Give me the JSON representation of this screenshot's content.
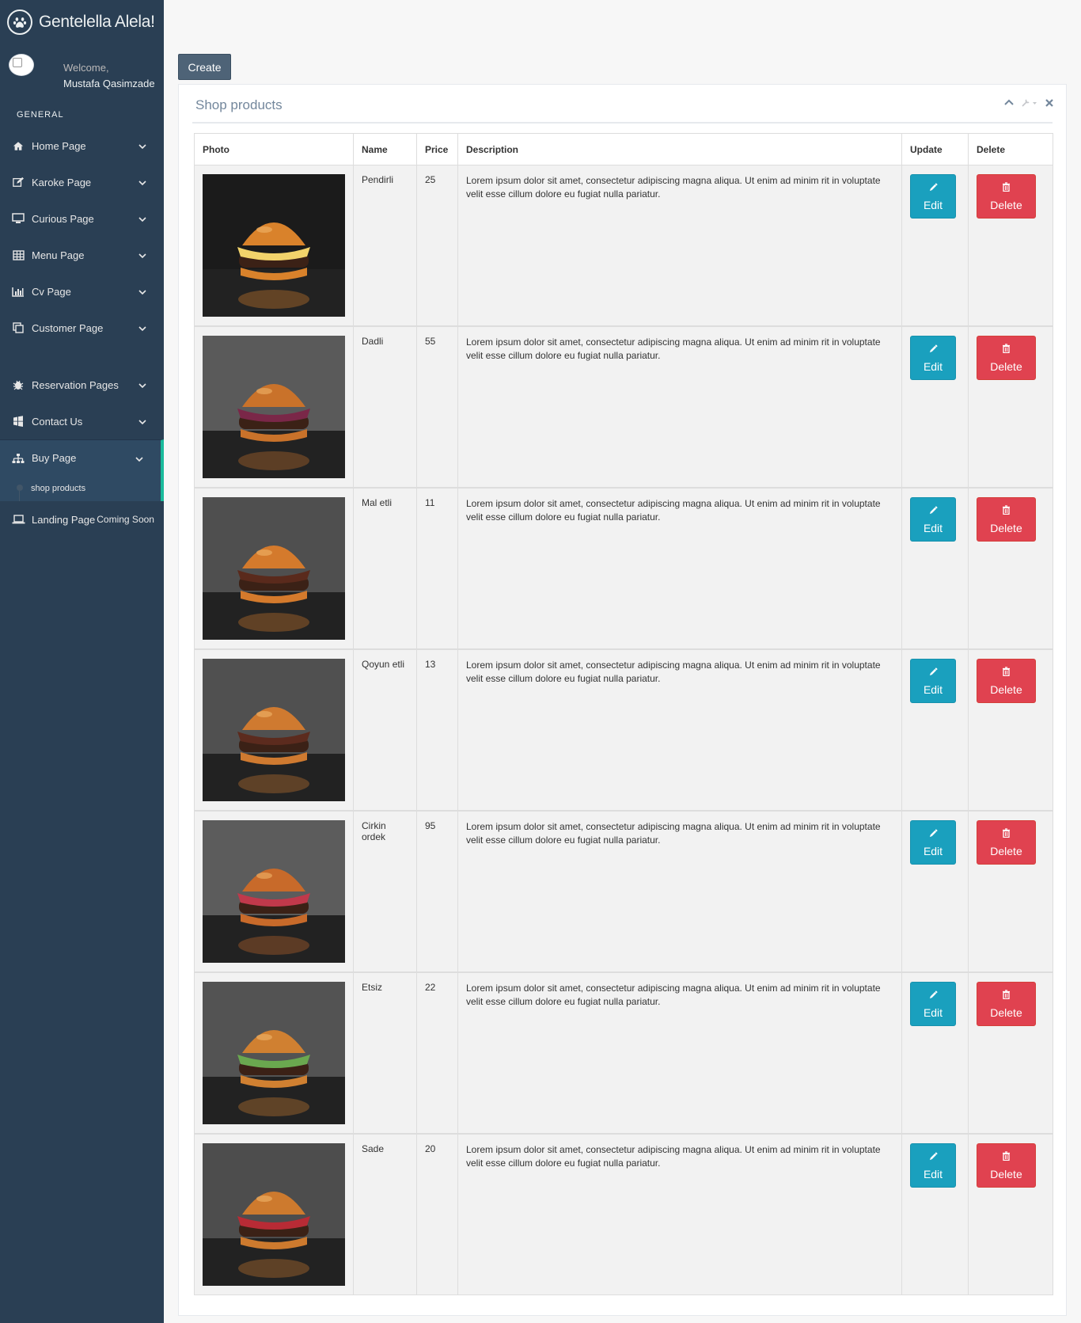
{
  "app": {
    "title": "Gentelella Alela!"
  },
  "profile": {
    "welcome": "Welcome,",
    "name": "Mustafa Qasimzade"
  },
  "sidebar": {
    "heading": "GENERAL",
    "items": [
      {
        "label": "Home Page",
        "icon": "home-icon"
      },
      {
        "label": "Karoke Page",
        "icon": "edit-icon"
      },
      {
        "label": "Curious Page",
        "icon": "desktop-icon"
      },
      {
        "label": "Menu Page",
        "icon": "table-icon"
      },
      {
        "label": "Cv Page",
        "icon": "bar-chart-icon"
      },
      {
        "label": "Customer Page",
        "icon": "clone-icon"
      },
      {
        "label": "Reservation Pages",
        "icon": "bug-icon"
      },
      {
        "label": "Contact Us",
        "icon": "windows-icon"
      },
      {
        "label": "Buy Page",
        "icon": "sitemap-icon"
      }
    ],
    "subitem": "shop products",
    "landing": {
      "label": "Landing Page",
      "badge": "Coming Soon",
      "icon": "laptop-icon"
    }
  },
  "toolbar": {
    "create_label": "Create"
  },
  "panel": {
    "title": "Shop products"
  },
  "table": {
    "headers": [
      "Photo",
      "Name",
      "Price",
      "Description",
      "Update",
      "Delete"
    ],
    "edit_label": "Edit",
    "delete_label": "Delete",
    "rows": [
      {
        "name": "Pendirli",
        "price": "25",
        "description": "Lorem ipsum dolor sit amet, consectetur adipiscing magna aliqua. Ut enim ad minim rit in voluptate velit esse cillum dolore eu fugiat nulla pariatur."
      },
      {
        "name": "Dadli",
        "price": "55",
        "description": "Lorem ipsum dolor sit amet, consectetur adipiscing magna aliqua. Ut enim ad minim rit in voluptate velit esse cillum dolore eu fugiat nulla pariatur."
      },
      {
        "name": "Mal etli",
        "price": "11",
        "description": "Lorem ipsum dolor sit amet, consectetur adipiscing magna aliqua. Ut enim ad minim rit in voluptate velit esse cillum dolore eu fugiat nulla pariatur."
      },
      {
        "name": "Qoyun etli",
        "price": "13",
        "description": "Lorem ipsum dolor sit amet, consectetur adipiscing magna aliqua. Ut enim ad minim rit in voluptate velit esse cillum dolore eu fugiat nulla pariatur."
      },
      {
        "name": "Cirkin ordek",
        "price": "95",
        "description": "Lorem ipsum dolor sit amet, consectetur adipiscing magna aliqua. Ut enim ad minim rit in voluptate velit esse cillum dolore eu fugiat nulla pariatur."
      },
      {
        "name": "Etsiz",
        "price": "22",
        "description": "Lorem ipsum dolor sit amet, consectetur adipiscing magna aliqua. Ut enim ad minim rit in voluptate velit esse cillum dolore eu fugiat nulla pariatur."
      },
      {
        "name": "Sade",
        "price": "20",
        "description": "Lorem ipsum dolor sit amet, consectetur adipiscing magna aliqua. Ut enim ad minim rit in voluptate velit esse cillum dolore eu fugiat nulla pariatur."
      }
    ]
  },
  "colors": {
    "sidebar": "#2a3f54",
    "accent": "#1abb9c",
    "edit": "#1aa0be",
    "delete": "#e04250"
  }
}
